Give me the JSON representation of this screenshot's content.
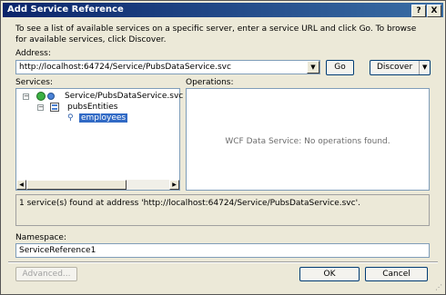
{
  "window": {
    "title": "Add Service Reference",
    "help_button": "?",
    "close_button": "X"
  },
  "instructions": "To see a list of available services on a specific server, enter a service URL and click Go. To browse for available services, click Discover.",
  "address": {
    "label": "Address:",
    "value": "http://localhost:64724/Service/PubsDataService.svc",
    "go_button": "Go",
    "discover_button": "Discover"
  },
  "services": {
    "label": "Services:",
    "tree": [
      {
        "label": "Service/PubsDataService.svc"
      },
      {
        "label": "pubsEntities"
      },
      {
        "label": "employees",
        "selected": true
      }
    ]
  },
  "operations": {
    "label": "Operations:",
    "empty_message": "WCF Data Service: No operations found."
  },
  "status_message": "1 service(s) found at address 'http://localhost:64724/Service/PubsDataService.svc'.",
  "namespace": {
    "label": "Namespace:",
    "value": "ServiceReference1"
  },
  "buttons": {
    "advanced": "Advanced...",
    "ok": "OK",
    "cancel": "Cancel"
  },
  "colors": {
    "title_bar": "#0a246a",
    "selection": "#316ac5",
    "dialog_face": "#ece9d8"
  }
}
